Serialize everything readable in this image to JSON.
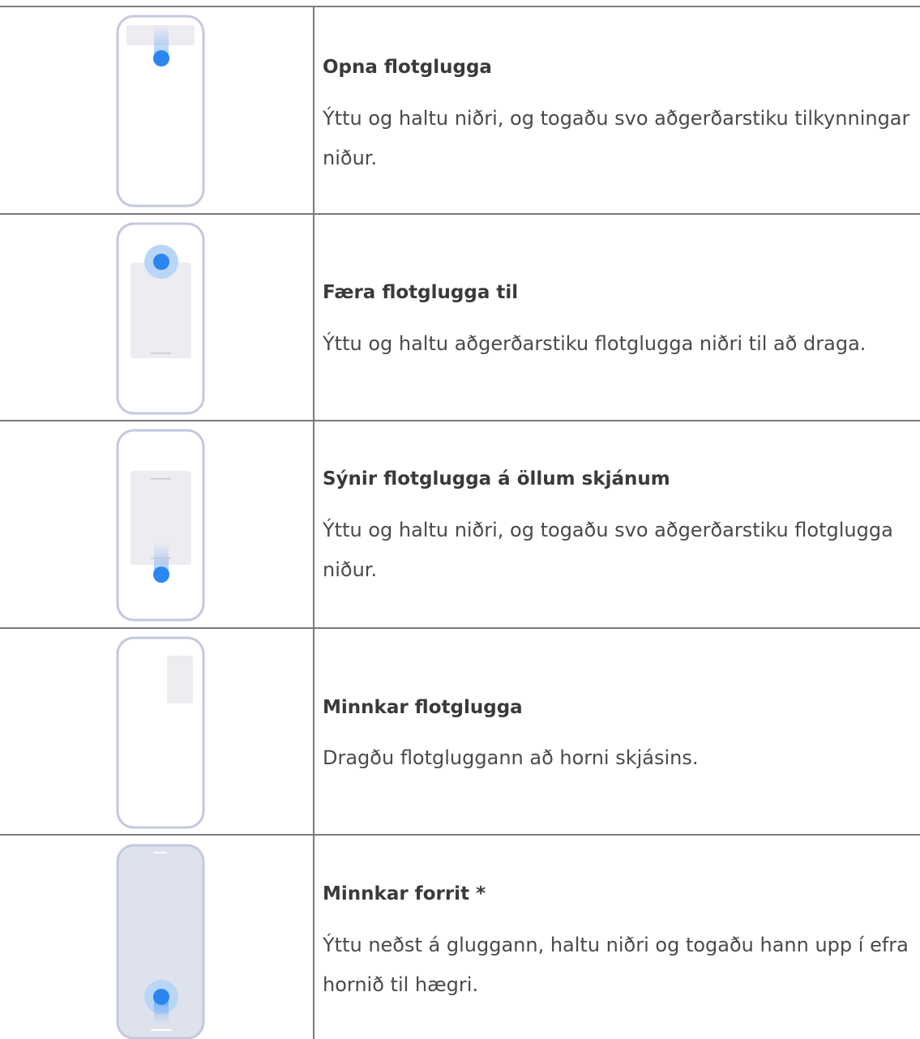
{
  "rows": [
    {
      "title": "Opna flotglugga",
      "description": "Ýttu og haltu niðri, og togaðu svo aðgerðarstiku tilkynn­ingar niður.",
      "illustration_icon": "swipe-down-notification-icon"
    },
    {
      "title": "Færa flotglugga til",
      "description": "Ýttu og haltu aðgerðarstiku flotglugga niðri til að draga.",
      "illustration_icon": "drag-floating-window-icon"
    },
    {
      "title": "Sýnir flotglugga á öllum skjánum",
      "description": "Ýttu og haltu niðri, og togaðu svo aðgerðarstiku flotg­lugga niður.",
      "illustration_icon": "expand-floating-window-icon"
    },
    {
      "title": "Minnkar flotglugga",
      "description": "Dragðu flotgluggann að horni skjásins.",
      "illustration_icon": "minimize-floating-window-icon"
    },
    {
      "title": "Minnkar forrit *",
      "description": "Ýttu neðst á gluggann, haltu niðri og togaðu hann upp í efra hornið til hægri.",
      "illustration_icon": "minimize-app-icon"
    }
  ],
  "colors": {
    "grid_line": "#7a7a7a",
    "phone_outline": "#c4c9dc",
    "panel_fill": "#ececf1",
    "touch_dot": "#2b86f0",
    "touch_halo": "#b9d6f6",
    "app_fill": "#dde2ec"
  }
}
